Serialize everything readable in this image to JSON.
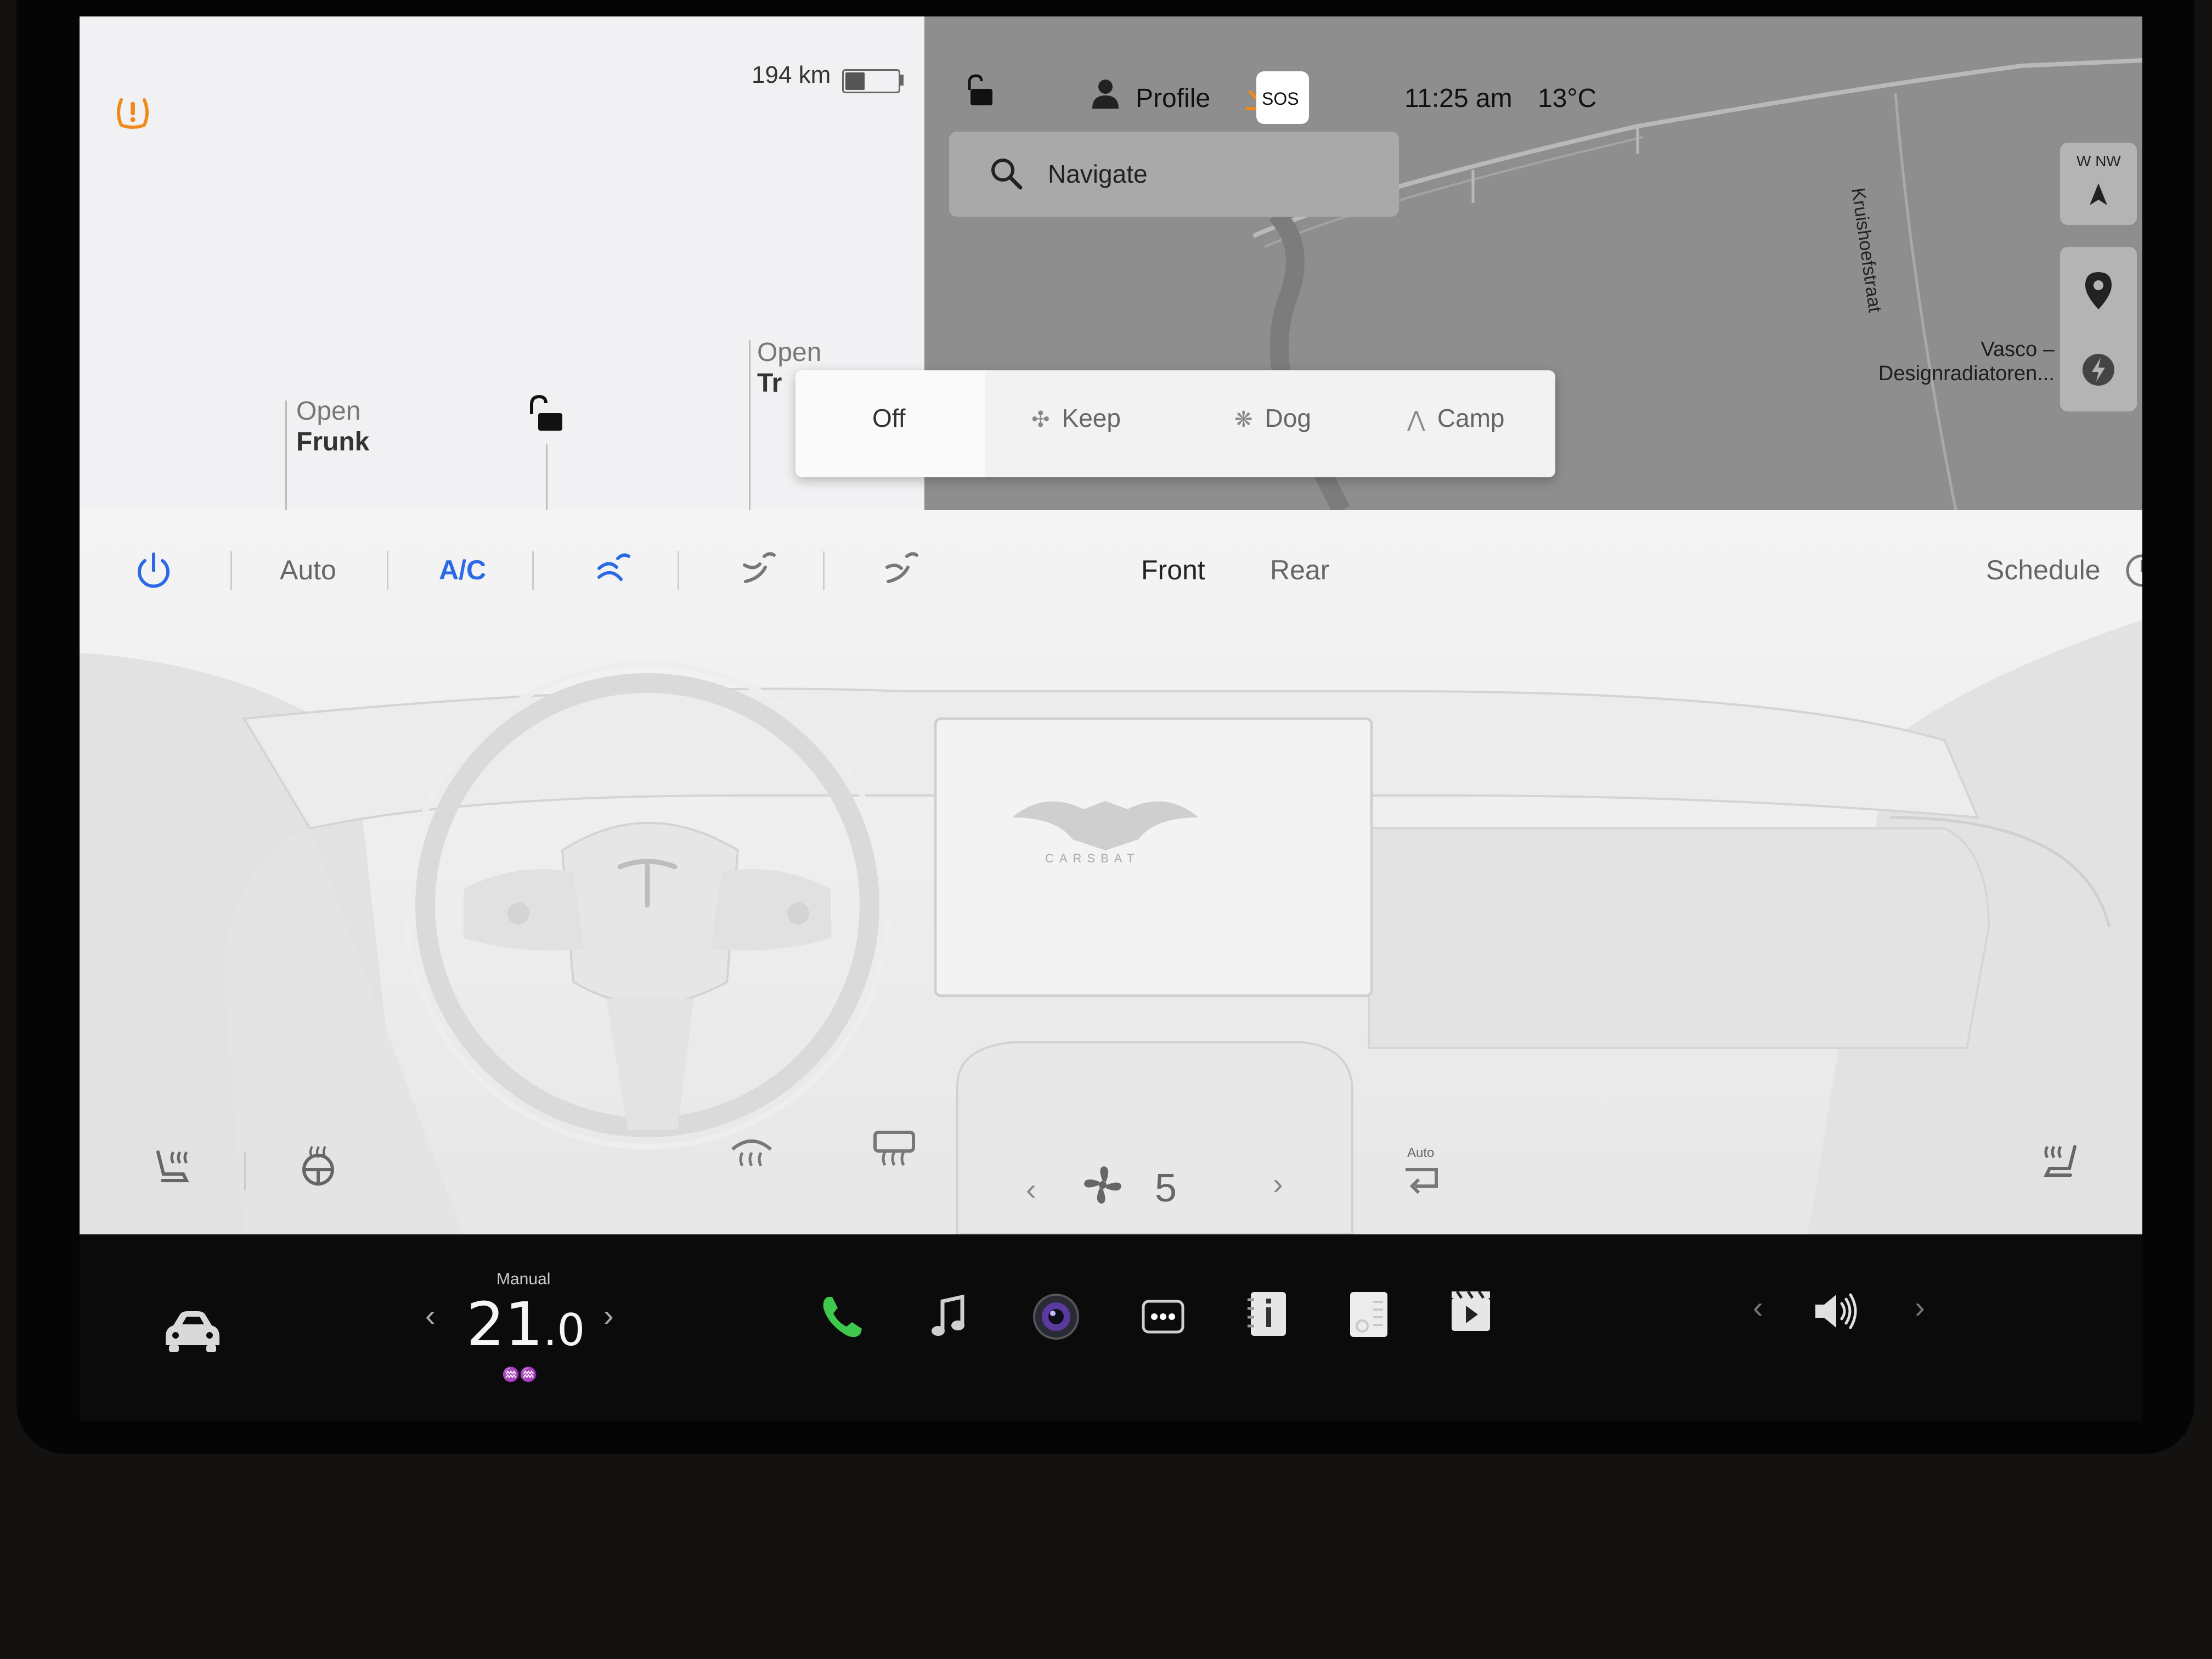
{
  "car_panel": {
    "range": "194 km",
    "battery_level": 0.35,
    "frunk": {
      "prefix": "Open",
      "label": "Frunk"
    },
    "trunk": {
      "prefix": "Open",
      "label_partial": "Tr"
    }
  },
  "status_bar": {
    "profile_label": "Profile",
    "sos_label": "SOS",
    "time": "11:25 am",
    "temperature": "13°C",
    "download_color": "#f08a1c",
    "warning_color": "#f08a1c"
  },
  "search": {
    "placeholder": "Navigate"
  },
  "map": {
    "street_label": "Kruishoefstraat",
    "place_label_line1": "Vasco –",
    "place_label_line2": "Designradiatoren...",
    "compass_letters": "W  NW"
  },
  "sentry_popup": {
    "options": [
      {
        "label": "Off",
        "icon": "off",
        "selected": true
      },
      {
        "label": "Keep",
        "icon": "fan-icon"
      },
      {
        "label": "Dog",
        "icon": "paw-icon"
      },
      {
        "label": "Camp",
        "icon": "tent-icon"
      }
    ]
  },
  "climate": {
    "power_color": "#2c6ae5",
    "auto_label": "Auto",
    "ac_label": "A/C",
    "ac_color": "#2c6ae5",
    "zone_front": "Front",
    "zone_rear": "Rear",
    "schedule_label": "Schedule",
    "fan_speed": "5",
    "recirc_mode": "Auto",
    "logo_text": "CARSBAT"
  },
  "taskbar": {
    "temp_mode": "Manual",
    "temp_whole": "21",
    "temp_decimal": ".0",
    "phone_color": "#3ec84c"
  }
}
